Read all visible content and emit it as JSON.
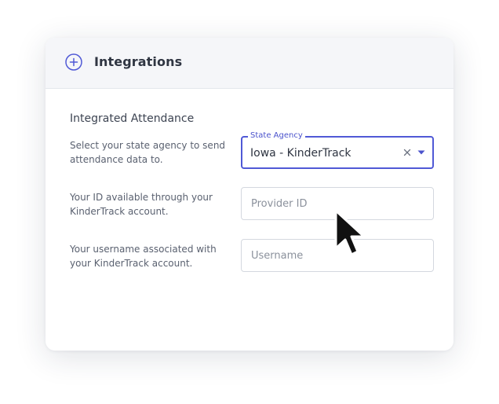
{
  "header": {
    "title": "Integrations",
    "icon": "plus-circle-icon"
  },
  "section": {
    "title": "Integrated Attendance"
  },
  "rows": {
    "state_agency": {
      "description": "Select your state agency to send attendance data to.",
      "legend": "State Agency",
      "value": "Iowa - KinderTrack",
      "clear_icon": "close-icon",
      "dropdown_icon": "caret-down-icon"
    },
    "provider_id": {
      "description": "Your ID available through your KinderTrack account.",
      "placeholder": "Provider ID"
    },
    "username": {
      "description": "Your username associated with your KinderTrack account.",
      "placeholder": "Username"
    }
  },
  "colors": {
    "accent": "#5059d6",
    "header_bg": "#f5f6f9",
    "text": "#2f3542",
    "muted": "#5a6170",
    "placeholder": "#8b919c"
  },
  "cursor": "arrow-pointer-icon"
}
